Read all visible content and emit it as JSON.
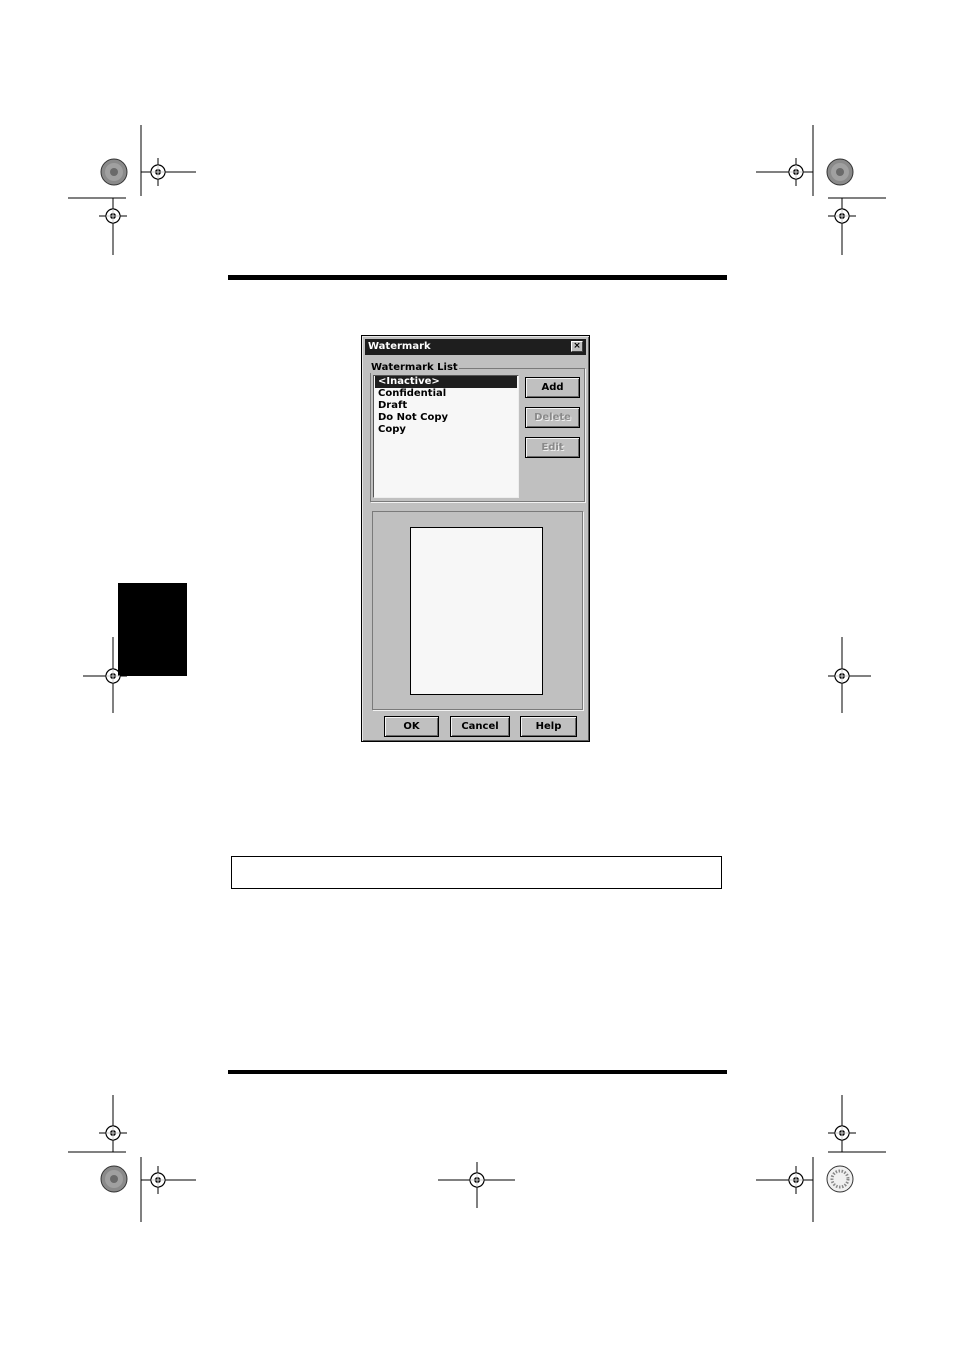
{
  "dialog": {
    "title": "Watermark",
    "close_label": "×",
    "group_label": "Watermark List",
    "list_items": [
      "<Inactive>",
      "Confidential",
      "Draft",
      "Do Not Copy",
      "Copy"
    ],
    "selected_index": 0,
    "buttons": {
      "add": "Add",
      "delete": "Delete",
      "edit": "Edit",
      "ok": "OK",
      "cancel": "Cancel",
      "help": "Help"
    }
  },
  "note_box": {
    "text": ""
  }
}
